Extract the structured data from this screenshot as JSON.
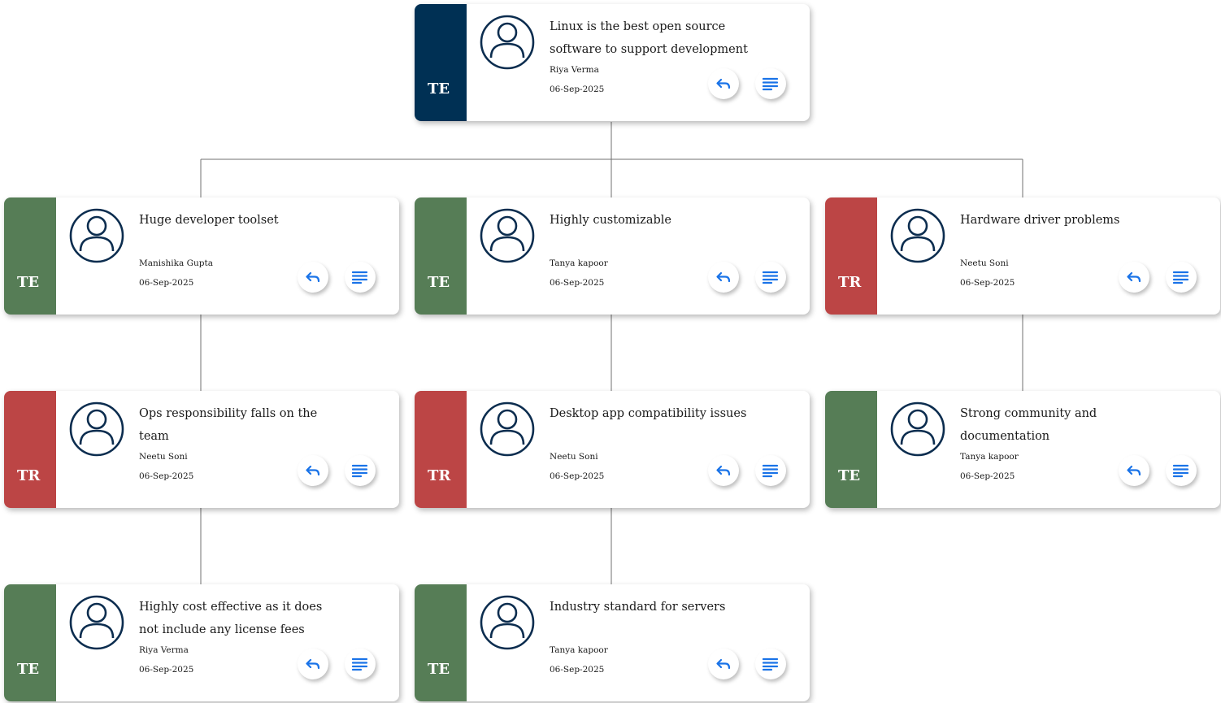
{
  "colors": {
    "root_stripe": "#003054",
    "te_stripe": "#567d56",
    "tr_stripe": "#bc4545",
    "icon_blue": "#1a73e8",
    "avatar_stroke": "#0c2d4f",
    "connector": "#707070"
  },
  "icons": {
    "avatar": "user-circle-icon",
    "reply": "reply-arrow-icon",
    "details": "notes-lines-icon"
  },
  "nodes": [
    {
      "id": "n0",
      "type_code": "TE",
      "stripe": "root_stripe",
      "title": "Linux is the best open source software to support development",
      "author": "Riya Verma",
      "date": "06-Sep-2025"
    },
    {
      "id": "n1",
      "type_code": "TE",
      "stripe": "te_stripe",
      "title": "Huge developer toolset",
      "author": "Manishika Gupta",
      "date": "06-Sep-2025"
    },
    {
      "id": "n2",
      "type_code": "TE",
      "stripe": "te_stripe",
      "title": "Highly customizable",
      "author": "Tanya kapoor",
      "date": "06-Sep-2025"
    },
    {
      "id": "n3",
      "type_code": "TR",
      "stripe": "tr_stripe",
      "title": "Hardware driver problems",
      "author": "Neetu Soni",
      "date": "06-Sep-2025"
    },
    {
      "id": "n4",
      "type_code": "TR",
      "stripe": "tr_stripe",
      "title": "Ops responsibility falls on the team",
      "author": "Neetu Soni",
      "date": "06-Sep-2025"
    },
    {
      "id": "n5",
      "type_code": "TR",
      "stripe": "tr_stripe",
      "title": "Desktop app compatibility issues",
      "author": "Neetu Soni",
      "date": "06-Sep-2025"
    },
    {
      "id": "n6",
      "type_code": "TE",
      "stripe": "te_stripe",
      "title": "Strong community and documentation",
      "author": "Tanya kapoor",
      "date": "06-Sep-2025"
    },
    {
      "id": "n7",
      "type_code": "TE",
      "stripe": "te_stripe",
      "title": "Highly cost effective as it does not include any license fees",
      "author": "Riya Verma",
      "date": "06-Sep-2025"
    },
    {
      "id": "n8",
      "type_code": "TE",
      "stripe": "te_stripe",
      "title": "Industry standard for servers",
      "author": "Tanya kapoor",
      "date": "06-Sep-2025"
    }
  ]
}
